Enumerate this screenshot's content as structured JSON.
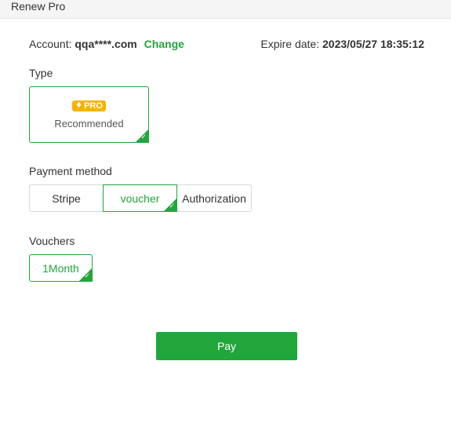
{
  "window": {
    "title": "Renew Pro"
  },
  "account": {
    "label": "Account:",
    "user": "qqa****.com",
    "change_label": "Change"
  },
  "expire": {
    "label": "Expire date:",
    "date": "2023/05/27 18:35:12"
  },
  "type_section": {
    "label": "Type",
    "badge_text": "PRO",
    "badge_icon": "diamond-icon",
    "option_label": "Recommended",
    "selected": true
  },
  "payment_section": {
    "label": "Payment method",
    "options": [
      {
        "label": "Stripe",
        "selected": false
      },
      {
        "label": "voucher",
        "selected": true
      },
      {
        "label": "Authorization",
        "selected": false
      }
    ]
  },
  "vouchers_section": {
    "label": "Vouchers",
    "options": [
      {
        "label": "1Month",
        "selected": true
      }
    ]
  },
  "pay_button": {
    "label": "Pay"
  },
  "colors": {
    "accent": "#21a63b",
    "badge": "#f5b400",
    "border": "#d9d9d9"
  }
}
